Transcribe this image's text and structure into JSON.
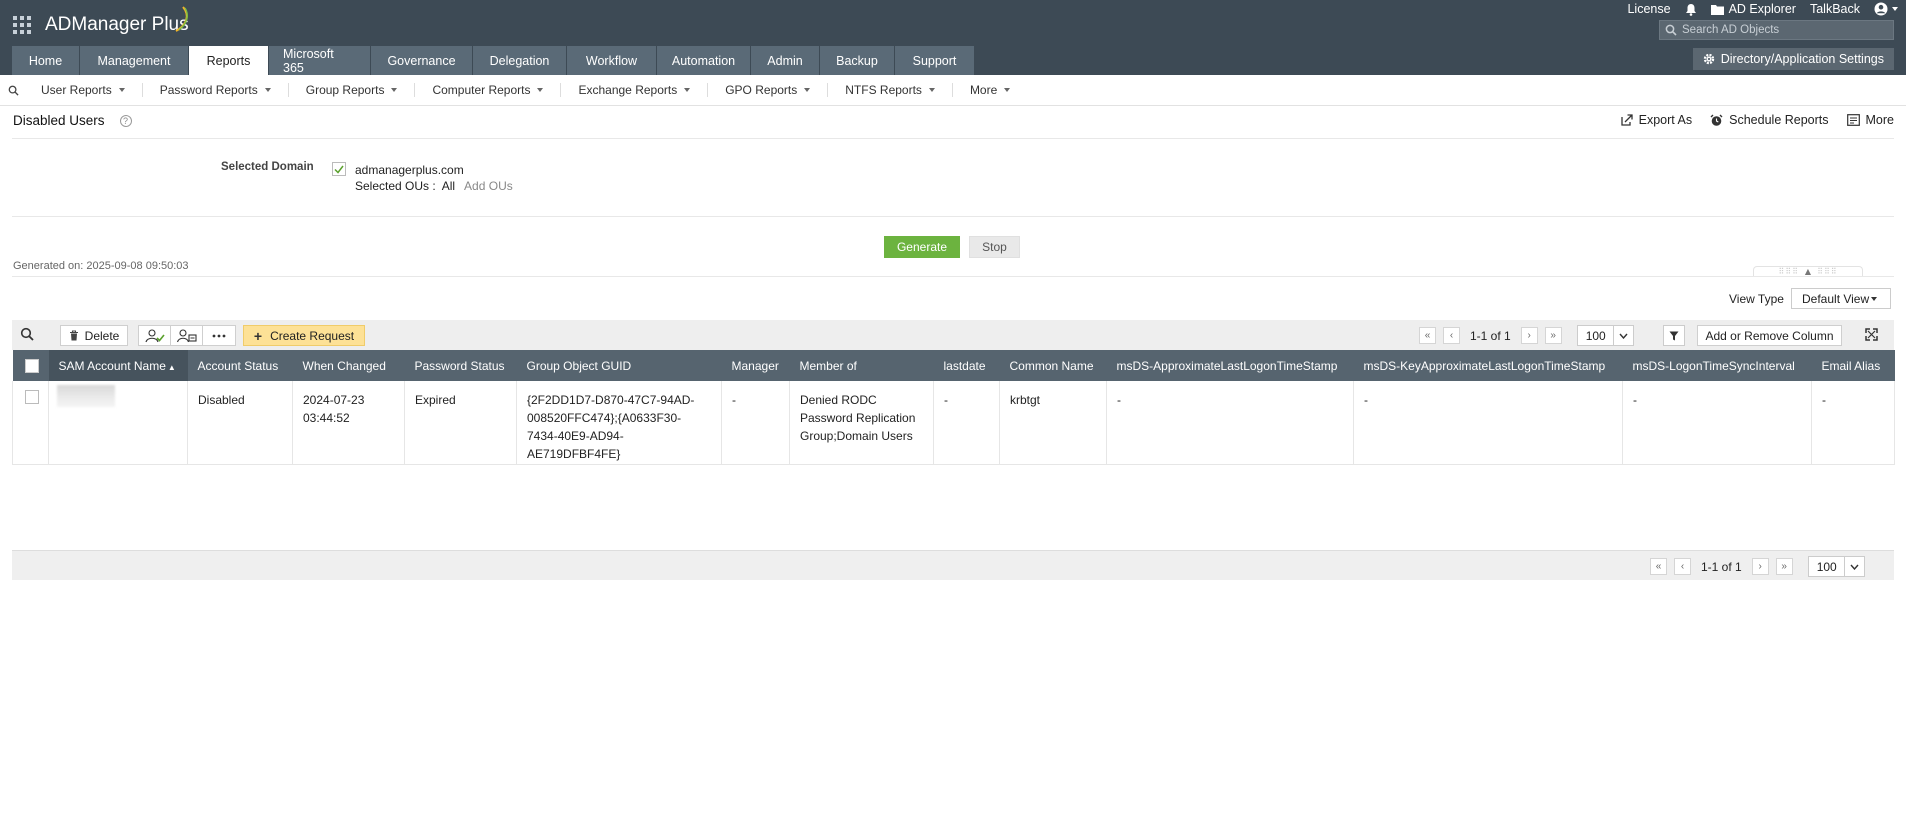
{
  "header": {
    "app_name": "ADManager Plus",
    "links": {
      "license": "License",
      "ad_explorer": "AD Explorer",
      "talkback": "TalkBack"
    },
    "search_placeholder": "Search AD Objects",
    "settings_label": "Directory/Application Settings",
    "tabs": [
      {
        "label": "Home"
      },
      {
        "label": "Management"
      },
      {
        "label": "Reports",
        "active": true
      },
      {
        "label": "Microsoft 365"
      },
      {
        "label": "Governance"
      },
      {
        "label": "Delegation"
      },
      {
        "label": "Workflow"
      },
      {
        "label": "Automation"
      },
      {
        "label": "Admin"
      },
      {
        "label": "Backup"
      },
      {
        "label": "Support"
      }
    ]
  },
  "subnav": {
    "items": [
      {
        "label": "User Reports"
      },
      {
        "label": "Password Reports"
      },
      {
        "label": "Group Reports"
      },
      {
        "label": "Computer Reports"
      },
      {
        "label": "Exchange Reports"
      },
      {
        "label": "GPO Reports"
      },
      {
        "label": "NTFS Reports"
      },
      {
        "label": "More"
      }
    ]
  },
  "page": {
    "title": "Disabled Users",
    "help": "?",
    "actions": {
      "export": "Export As",
      "schedule": "Schedule Reports",
      "more": "More"
    }
  },
  "domain": {
    "label": "Selected Domain",
    "name": "admanagerplus.com",
    "ous_label": "Selected OUs :",
    "ous_value": "All",
    "add_ous": "Add OUs"
  },
  "buttons": {
    "generate": "Generate",
    "stop": "Stop"
  },
  "generated_on": "Generated on: 2025-09-08 09:50:03",
  "view": {
    "label": "View Type",
    "value": "Default View"
  },
  "toolbar": {
    "delete": "Delete",
    "create_request": "Create Request",
    "add_remove_column": "Add or Remove Column",
    "page_info": "1-1 of 1",
    "page_size": "100"
  },
  "table": {
    "columns": [
      {
        "label": "SAM Account Name",
        "sorted": true
      },
      {
        "label": "Account Status"
      },
      {
        "label": "When Changed"
      },
      {
        "label": "Password Status"
      },
      {
        "label": "Group Object GUID"
      },
      {
        "label": "Manager"
      },
      {
        "label": "Member of"
      },
      {
        "label": "lastdate"
      },
      {
        "label": "Common Name"
      },
      {
        "label": "msDS-ApproximateLastLogonTimeStamp"
      },
      {
        "label": "msDS-KeyApproximateLastLogonTimeStamp"
      },
      {
        "label": "msDS-LogonTimeSyncInterval"
      },
      {
        "label": "Email Alias"
      }
    ],
    "rows": [
      {
        "sam": "",
        "status": "Disabled",
        "when_changed_1": "2024-07-23",
        "when_changed_2": "03:44:52",
        "password_status": "Expired",
        "guid_1": "{2F2DD1D7-D870-47C7-94AD-",
        "guid_2": "008520FFC474};{A0633F30-",
        "guid_3": "7434-40E9-AD94-",
        "guid_4": "AE719DFBF4FE}",
        "manager": "-",
        "member_1": "Denied RODC",
        "member_2": "Password Replication",
        "member_3": "Group;Domain Users",
        "lastdate": "-",
        "common_name": "krbtgt",
        "approx_logon": "-",
        "key_approx_logon": "-",
        "sync_interval": "-",
        "email_alias": "-"
      }
    ]
  },
  "colors": {
    "header_bg": "#3d4a55",
    "tab_bg": "#5a6a77",
    "table_header": "#56646f",
    "generate": "#6cb33f",
    "create_request": "#fde196"
  }
}
